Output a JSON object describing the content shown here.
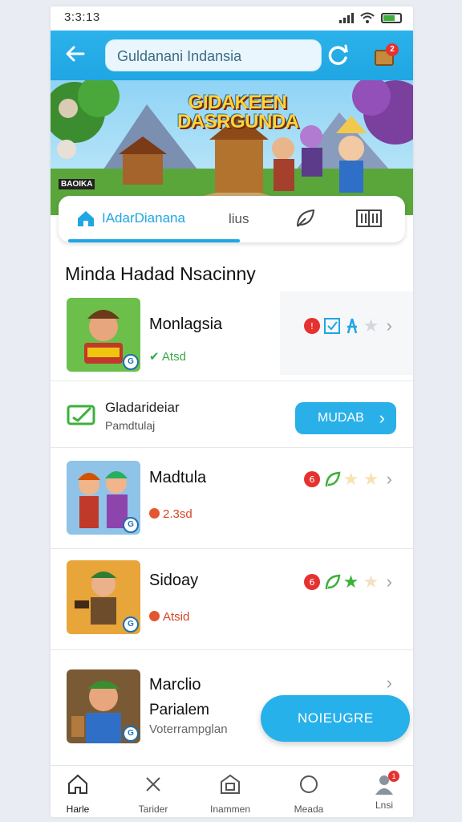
{
  "status_bar": {
    "time": "3:3:13"
  },
  "top_bar": {
    "search_text": "Guldanani Indansia",
    "cart_badge": "2"
  },
  "hero": {
    "title": "GIDAKEEN DASRGUNDA",
    "caption": "BAOIKA"
  },
  "tabs": [
    {
      "label": "IAdarDianana",
      "icon": "home-icon",
      "active": true
    },
    {
      "label": "lius"
    },
    {
      "label": "",
      "icon": "leaf-icon"
    },
    {
      "label": "",
      "icon": "book-icon"
    }
  ],
  "section_title": "Minda Hadad Nsacinny",
  "items": [
    {
      "name": "Monlagsia",
      "sub": "Atsd",
      "sub_color": "green",
      "rating_icons": [
        "red-badge-icon",
        "blue-check-icon",
        "person-icon",
        "star-icon"
      ]
    },
    {
      "name": "Madtula",
      "sub": "2.3sd",
      "sub_color": "red",
      "rating_icons": [
        "red-badge-icon",
        "leaf-icon",
        "star-icon",
        "star-icon"
      ]
    },
    {
      "name": "Sidoay",
      "sub": "Atsid",
      "sub_color": "red",
      "rating_icons": [
        "red-badge-icon",
        "leaf-icon",
        "star-icon",
        "star-icon"
      ]
    },
    {
      "name": "Marclio",
      "sub_name": "Parialem",
      "sub": "Voterrampglan"
    }
  ],
  "promo": {
    "title": "Gladarideiar",
    "sub": "Pamdtulaj",
    "button": "MUDAB"
  },
  "fab_label": "NOIEUGRE",
  "bottom_nav": [
    {
      "label": "Harle",
      "icon": "home-icon",
      "active": true
    },
    {
      "label": "Tarider",
      "icon": "close-icon"
    },
    {
      "label": "Inammen",
      "icon": "store-icon"
    },
    {
      "label": "Meada",
      "icon": "circle-icon"
    },
    {
      "label": "Lnsi",
      "icon": "user-icon",
      "badge": "1"
    }
  ],
  "colors": {
    "accent": "#1fa6e3",
    "rating_red": "#e4572e",
    "success_green": "#37a845"
  }
}
